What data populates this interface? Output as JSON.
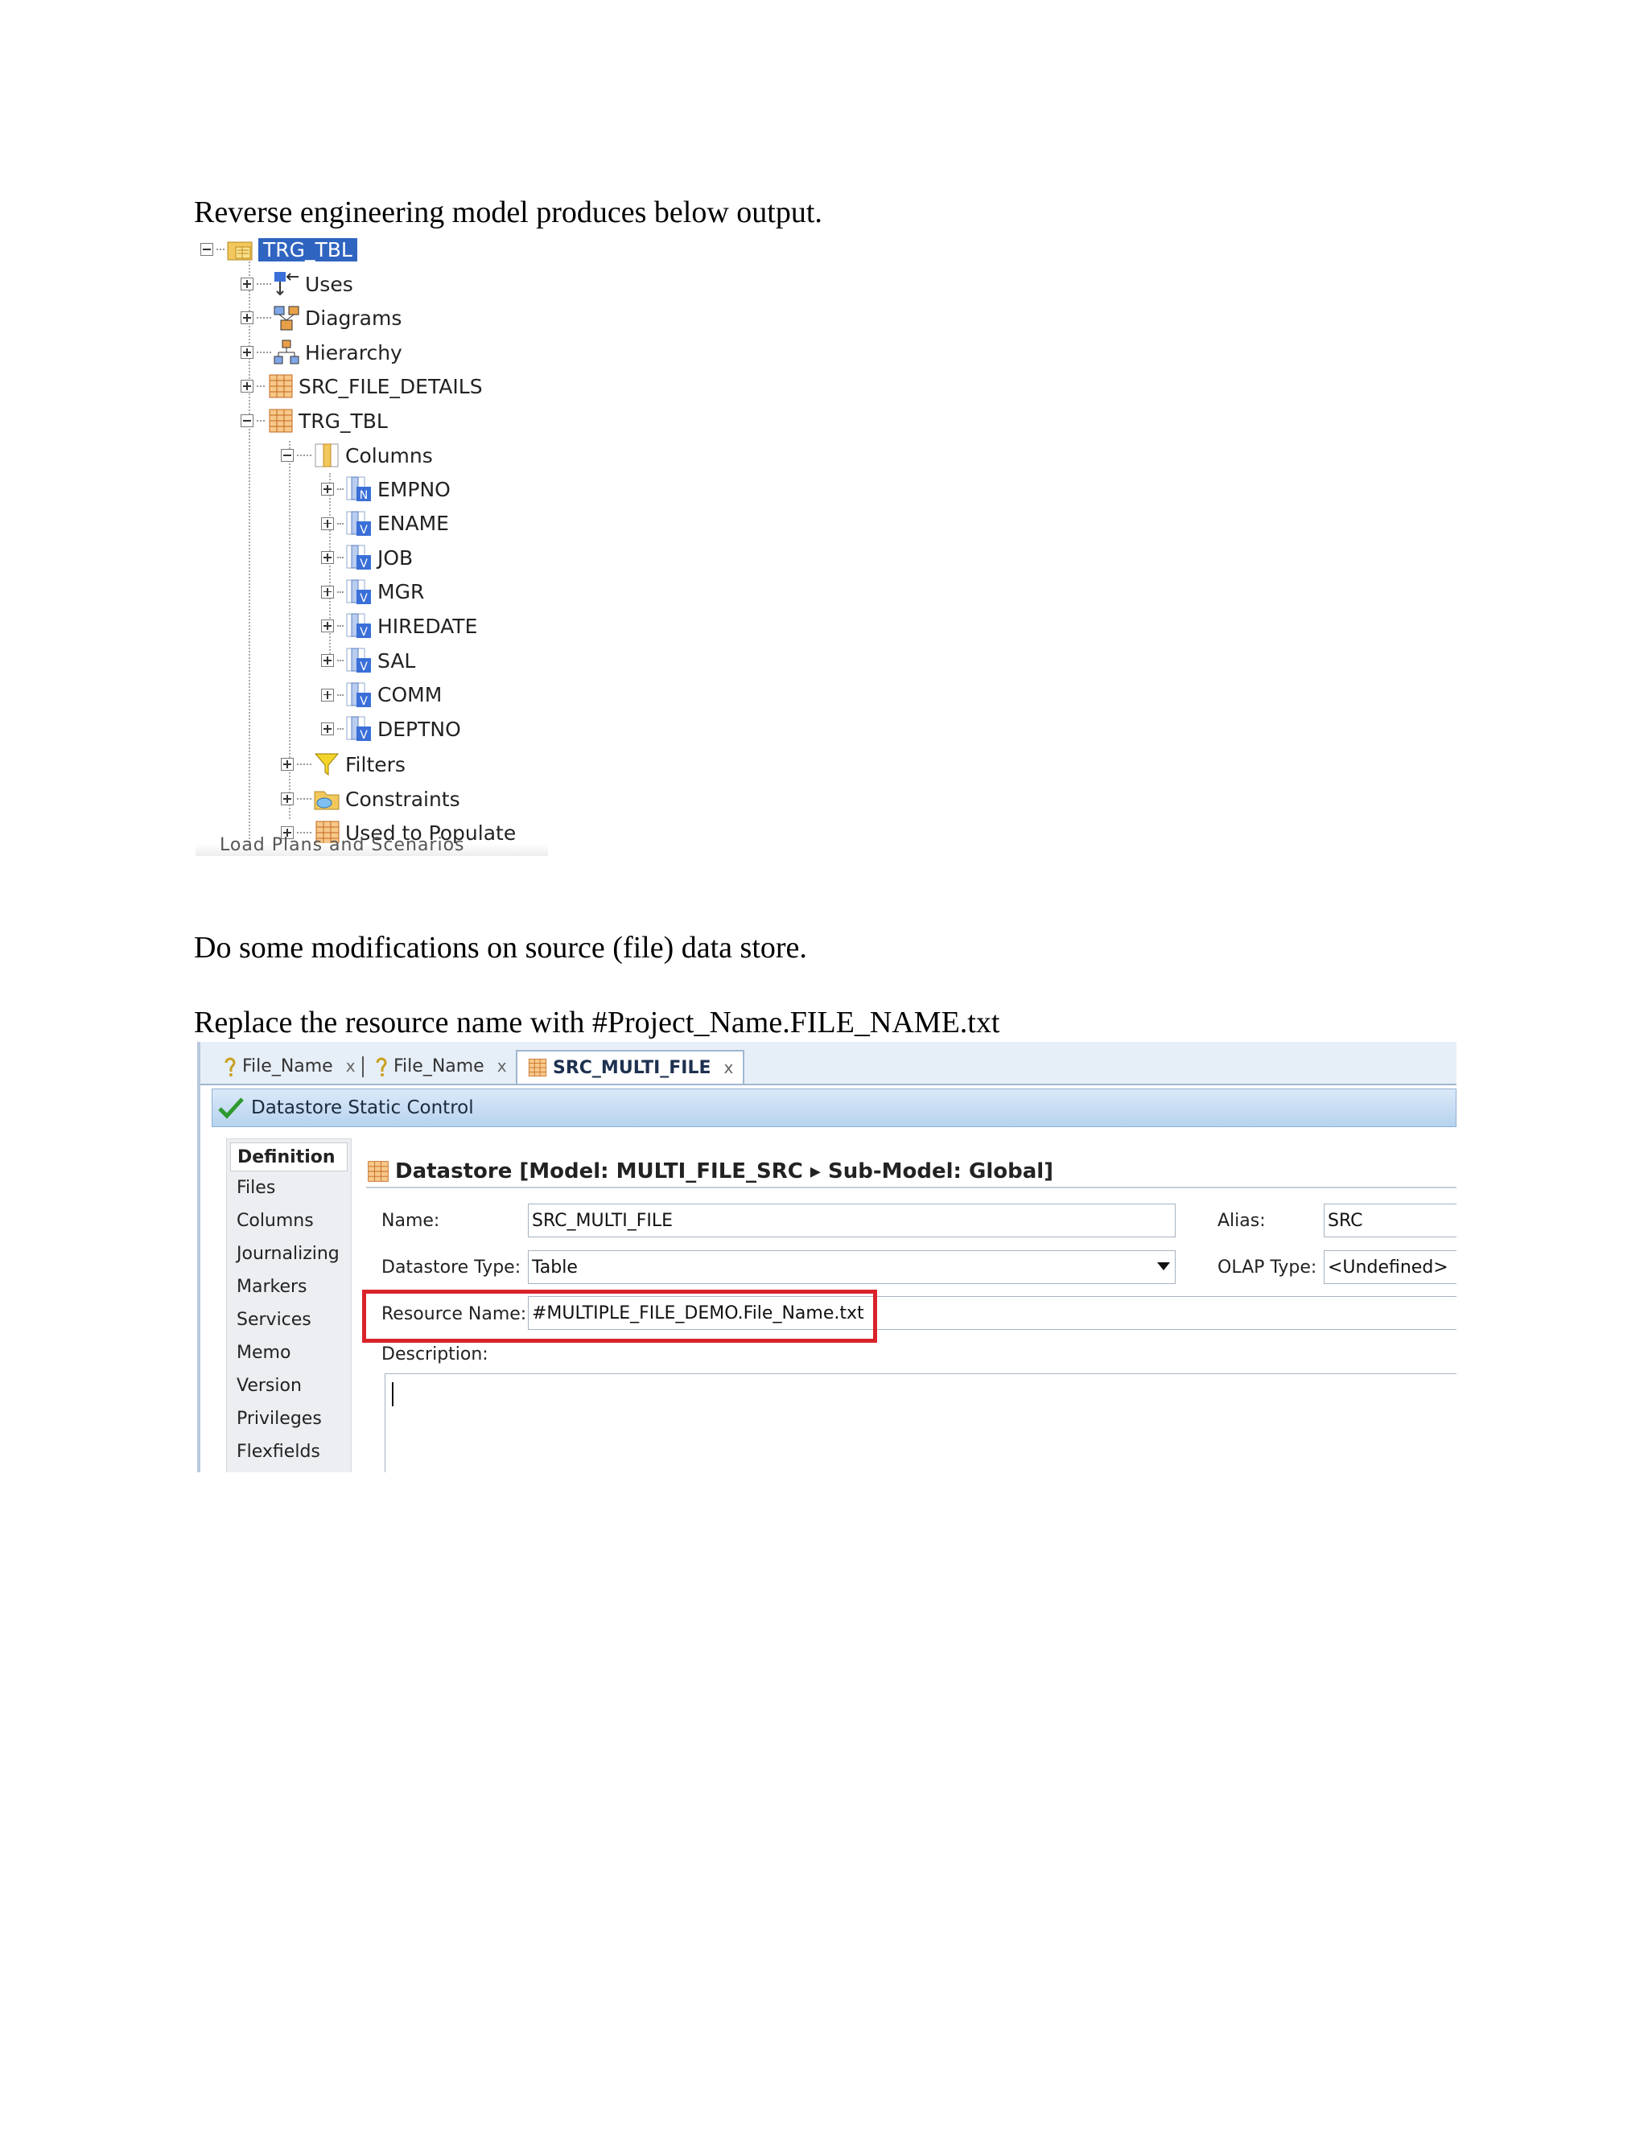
{
  "doc": {
    "para1": "Reverse engineering model produces below output.",
    "para2": "Do some modifications on source (file) data store.",
    "para3": "Replace the resource name with #Project_Name.FILE_NAME.txt"
  },
  "tree": {
    "root": "TRG_TBL",
    "uses": "Uses",
    "diagrams": "Diagrams",
    "hierarchy": "Hierarchy",
    "src_file_details": "SRC_FILE_DETAILS",
    "trg_tbl": "TRG_TBL",
    "columns": "Columns",
    "column_items": [
      "EMPNO",
      "ENAME",
      "JOB",
      "MGR",
      "HIREDATE",
      "SAL",
      "COMM",
      "DEPTNO"
    ],
    "filters": "Filters",
    "constraints": "Constraints",
    "used_to_populate": "Used to Populate",
    "cut_text": "Load Plans and Scenarios"
  },
  "editor": {
    "tabs": [
      "File_Name",
      "File_Name",
      "SRC_MULTI_FILE"
    ],
    "tab_close": "x",
    "title": "Datastore Static Control",
    "nav": [
      "Definition",
      "Files",
      "Columns",
      "Journalizing",
      "Markers",
      "Services",
      "Memo",
      "Version",
      "Privileges",
      "Flexfields"
    ],
    "header": "Datastore [Model: MULTI_FILE_SRC ▸ Sub-Model: Global]",
    "name_label": "Name:",
    "name_value": "SRC_MULTI_FILE",
    "alias_label": "Alias:",
    "alias_value": "SRC",
    "type_label": "Datastore Type:",
    "type_value": "Table",
    "olap_label": "OLAP Type:",
    "olap_value": "<Undefined>",
    "resource_label": "Resource Name:",
    "resource_value": "#MULTIPLE_FILE_DEMO.File_Name.txt",
    "desc_label": "Description:"
  },
  "colors": {
    "highlight": "#d8232a",
    "selection": "#2f64c0"
  }
}
